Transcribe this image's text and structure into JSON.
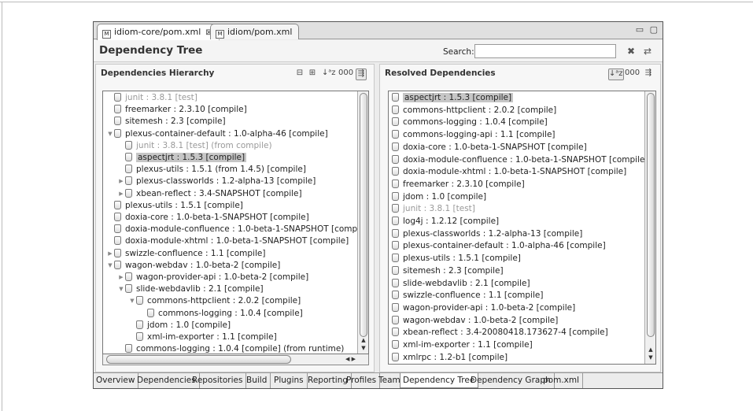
{
  "editor_tabs": [
    {
      "label": "idiom-core/pom.xml",
      "icon": "maven-file-icon",
      "active": true
    },
    {
      "label": "idiom/pom.xml",
      "icon": "maven-file-icon",
      "active": false
    }
  ],
  "editor_tab_close": "⊠",
  "window_controls": "▭ ▢",
  "page_title": "Dependency Tree",
  "search": {
    "label": "Search:",
    "value": "",
    "placeholder": ""
  },
  "header_icons": {
    "clear": "✖",
    "filter": "⇄"
  },
  "hierarchy": {
    "title": "Dependencies Hierarchy",
    "toolbar": {
      "collapse": "⊟",
      "expand": "⊞",
      "sort": "↓ᵃz",
      "tree": "000",
      "filter": "⇶"
    },
    "rows": [
      {
        "indent": 0,
        "twisty": "",
        "label": "junit : 3.8.1 [test]",
        "dim": true
      },
      {
        "indent": 0,
        "twisty": "",
        "label": "freemarker : 2.3.10 [compile]"
      },
      {
        "indent": 0,
        "twisty": "",
        "label": "sitemesh : 2.3 [compile]"
      },
      {
        "indent": 0,
        "twisty": "▼",
        "label": "plexus-container-default : 1.0-alpha-46 [compile]"
      },
      {
        "indent": 1,
        "twisty": "",
        "label": "junit : 3.8.1 [test] (from compile)",
        "dim": true
      },
      {
        "indent": 1,
        "twisty": "",
        "label": "aspectjrt : 1.5.3 [compile]",
        "selected": true
      },
      {
        "indent": 1,
        "twisty": "",
        "label": "plexus-utils : 1.5.1 (from 1.4.5) [compile]"
      },
      {
        "indent": 1,
        "twisty": "▶",
        "label": "plexus-classworlds : 1.2-alpha-13 [compile]"
      },
      {
        "indent": 1,
        "twisty": "▶",
        "label": "xbean-reflect : 3.4-SNAPSHOT [compile]"
      },
      {
        "indent": 0,
        "twisty": "",
        "label": "plexus-utils : 1.5.1 [compile]"
      },
      {
        "indent": 0,
        "twisty": "",
        "label": "doxia-core : 1.0-beta-1-SNAPSHOT [compile]"
      },
      {
        "indent": 0,
        "twisty": "",
        "label": "doxia-module-confluence : 1.0-beta-1-SNAPSHOT [compile]"
      },
      {
        "indent": 0,
        "twisty": "",
        "label": "doxia-module-xhtml : 1.0-beta-1-SNAPSHOT [compile]"
      },
      {
        "indent": 0,
        "twisty": "▶",
        "label": "swizzle-confluence : 1.1 [compile]"
      },
      {
        "indent": 0,
        "twisty": "▼",
        "label": "wagon-webdav : 1.0-beta-2 [compile]"
      },
      {
        "indent": 1,
        "twisty": "▶",
        "label": "wagon-provider-api : 1.0-beta-2 [compile]"
      },
      {
        "indent": 1,
        "twisty": "▼",
        "label": "slide-webdavlib : 2.1 [compile]"
      },
      {
        "indent": 2,
        "twisty": "▼",
        "label": "commons-httpclient : 2.0.2 [compile]"
      },
      {
        "indent": 3,
        "twisty": "",
        "label": "commons-logging : 1.0.4 [compile]"
      },
      {
        "indent": 2,
        "twisty": "",
        "label": "jdom : 1.0 [compile]"
      },
      {
        "indent": 2,
        "twisty": "",
        "label": "xml-im-exporter : 1.1 [compile]"
      },
      {
        "indent": 1,
        "twisty": "",
        "label": "commons-logging : 1.0.4 [compile] (from runtime)"
      }
    ]
  },
  "resolved": {
    "title": "Resolved Dependencies",
    "toolbar": {
      "sort": "↓ᵃz",
      "tree": "000",
      "filter": "⇶"
    },
    "rows": [
      {
        "label": "aspectjrt : 1.5.3 [compile]",
        "selected": true
      },
      {
        "label": "commons-httpclient : 2.0.2 [compile]"
      },
      {
        "label": "commons-logging : 1.0.4 [compile]"
      },
      {
        "label": "commons-logging-api : 1.1 [compile]"
      },
      {
        "label": "doxia-core : 1.0-beta-1-SNAPSHOT [compile]"
      },
      {
        "label": "doxia-module-confluence : 1.0-beta-1-SNAPSHOT [compile]"
      },
      {
        "label": "doxia-module-xhtml : 1.0-beta-1-SNAPSHOT [compile]"
      },
      {
        "label": "freemarker : 2.3.10 [compile]"
      },
      {
        "label": "jdom : 1.0 [compile]"
      },
      {
        "label": "junit : 3.8.1 [test]",
        "dim": true
      },
      {
        "label": "log4j : 1.2.12 [compile]"
      },
      {
        "label": "plexus-classworlds : 1.2-alpha-13 [compile]"
      },
      {
        "label": "plexus-container-default : 1.0-alpha-46 [compile]"
      },
      {
        "label": "plexus-utils : 1.5.1 [compile]"
      },
      {
        "label": "sitemesh : 2.3 [compile]"
      },
      {
        "label": "slide-webdavlib : 2.1 [compile]"
      },
      {
        "label": "swizzle-confluence : 1.1 [compile]"
      },
      {
        "label": "wagon-provider-api : 1.0-beta-2 [compile]"
      },
      {
        "label": "wagon-webdav : 1.0-beta-2 [compile]"
      },
      {
        "label": "xbean-reflect : 3.4-20080418.173627-4 [compile]"
      },
      {
        "label": "xml-im-exporter : 1.1 [compile]"
      },
      {
        "label": "xmlrpc : 1.2-b1 [compile]"
      }
    ]
  },
  "bottom_tabs": [
    {
      "label": "Overview"
    },
    {
      "label": "Dependencies"
    },
    {
      "label": "Repositories"
    },
    {
      "label": "Build"
    },
    {
      "label": "Plugins"
    },
    {
      "label": "Reporting"
    },
    {
      "label": "Profiles"
    },
    {
      "label": "Team"
    },
    {
      "label": "Dependency Tree",
      "active": true
    },
    {
      "label": "Dependency Graph"
    },
    {
      "label": "pom.xml"
    }
  ],
  "scroll_arrows": {
    "up": "▲",
    "down": "▼",
    "left": "◀",
    "right": "▶"
  }
}
